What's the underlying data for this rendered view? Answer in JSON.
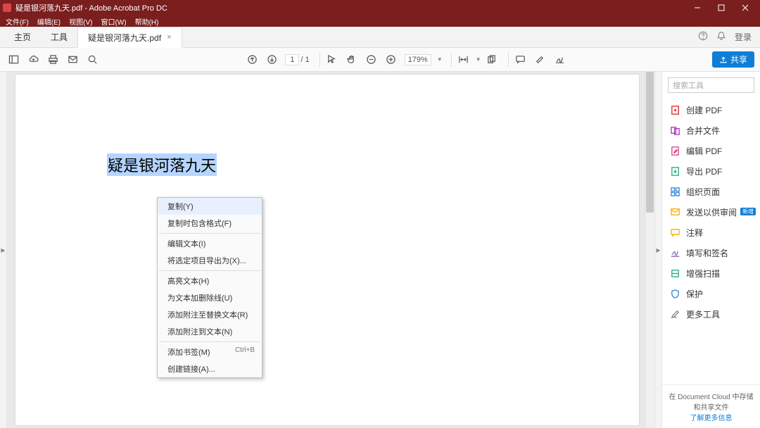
{
  "window": {
    "title": "疑是银河落九天.pdf - Adobe Acrobat Pro DC"
  },
  "menubar": {
    "file": "文件(F)",
    "edit": "编辑(E)",
    "view": "视图(V)",
    "window": "窗口(W)",
    "help": "帮助(H)"
  },
  "tabs": {
    "home": "主页",
    "tools": "工具",
    "doc": "疑是银河落九天.pdf"
  },
  "topright": {
    "login": "登录"
  },
  "toolbar": {
    "page_current": "1",
    "page_sep": "/",
    "page_total": "1",
    "zoom": "179%",
    "share": "共享"
  },
  "document": {
    "selected_text": "疑是银河落九天"
  },
  "context_menu": {
    "copy": "复制(Y)",
    "copy_fmt": "复制时包含格式(F)",
    "edit_text": "编辑文本(I)",
    "export_sel": "将选定项目导出为(X)...",
    "highlight": "高亮文本(H)",
    "strike": "为文本加删除线(U)",
    "replace_note": "添加附注至替换文本(R)",
    "add_note": "添加附注到文本(N)",
    "bookmark": "添加书签(M)",
    "bookmark_sc": "Ctrl+B",
    "link": "创建链接(A)..."
  },
  "side": {
    "search_placeholder": "搜索工具",
    "create_pdf": "创建 PDF",
    "combine": "合并文件",
    "edit_pdf": "编辑 PDF",
    "export_pdf": "导出 PDF",
    "organize": "组织页面",
    "send": "发送以供审阅",
    "send_badge": "新增",
    "comment": "注释",
    "fill_sign": "填写和签名",
    "enhance_scan": "增强扫描",
    "protect": "保护",
    "more_tools": "更多工具",
    "footer_line": "在 Document Cloud 中存储和共享文件",
    "footer_link": "了解更多信息"
  }
}
